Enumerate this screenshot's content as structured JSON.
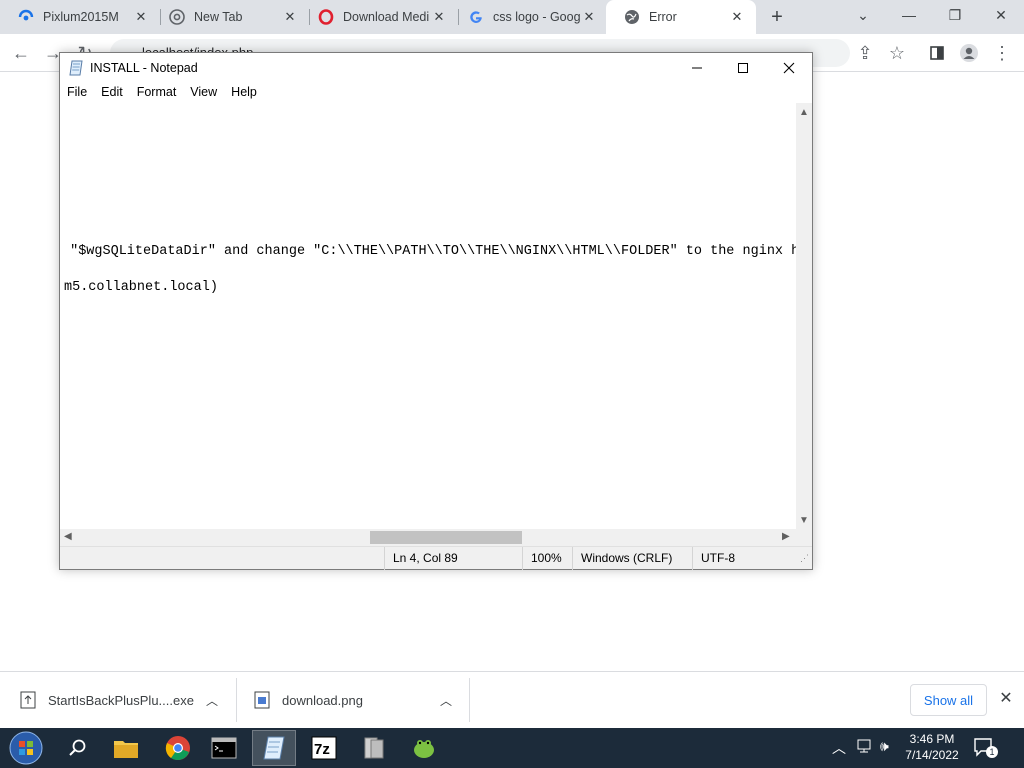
{
  "browser": {
    "tabs": [
      {
        "title": "Pixlum2015M",
        "favicon": "pixlum-icon"
      },
      {
        "title": "New Tab",
        "favicon": "chrome-icon"
      },
      {
        "title": "Download Medi",
        "favicon": "opera-icon"
      },
      {
        "title": "css logo - Goog",
        "favicon": "google-icon"
      },
      {
        "title": "Error",
        "favicon": "globe-icon",
        "active": true
      }
    ],
    "address": "localhost/index.php"
  },
  "notepad": {
    "title": "INSTALL - Notepad",
    "menu": [
      "File",
      "Edit",
      "Format",
      "View",
      "Help"
    ],
    "lines": [
      " \"$wgSQLiteDataDir\" and change \"C:\\\\THE\\\\PATH\\\\TO\\\\THE\\\\NGINX\\\\HTML\\\\FOLDER\" to the nginx ht",
      "m5.collabnet.local)"
    ],
    "status": {
      "position": "Ln 4, Col 89",
      "zoom": "100%",
      "line_ending": "Windows (CRLF)",
      "encoding": "UTF-8"
    }
  },
  "downloads": {
    "items": [
      {
        "name": "StartIsBackPlusPlu....exe"
      },
      {
        "name": "download.png"
      }
    ],
    "show_all": "Show all"
  },
  "taskbar": {
    "time": "3:46 PM",
    "date": "7/14/2022",
    "notification_count": "1"
  }
}
